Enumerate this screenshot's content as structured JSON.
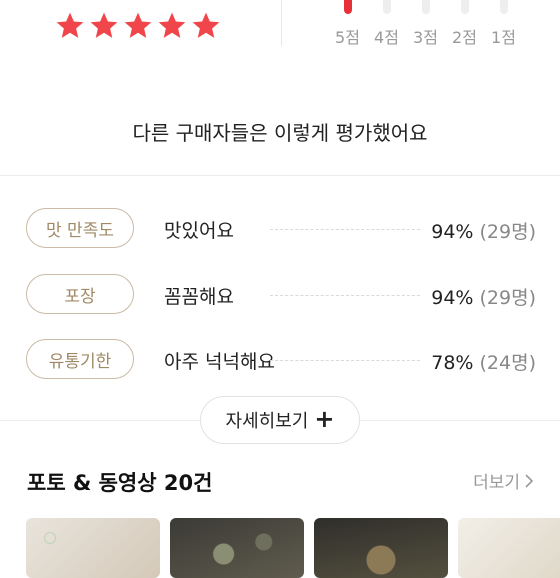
{
  "rating": {
    "stars": 5
  },
  "histogram": [
    {
      "label": "5점",
      "active": true
    },
    {
      "label": "4점",
      "active": false
    },
    {
      "label": "3점",
      "active": false
    },
    {
      "label": "2점",
      "active": false
    },
    {
      "label": "1점",
      "active": false
    }
  ],
  "summary": {
    "title": "다른 구매자들은 이렇게 평가했어요",
    "rows": [
      {
        "tag": "맛 만족도",
        "desc": "맛있어요",
        "pct": "94%",
        "count": "(29명)"
      },
      {
        "tag": "포장",
        "desc": "꼼꼼해요",
        "pct": "94%",
        "count": "(29명)"
      },
      {
        "tag": "유통기한",
        "desc": "아주 넉넉해요",
        "pct": "78%",
        "count": "(24명)"
      }
    ],
    "more_label": "자세히보기"
  },
  "media": {
    "title": "포토 & 동영상 20건",
    "more_label": "더보기"
  },
  "colors": {
    "star": "#f0454a",
    "accent_bar": "#e8303a",
    "tag_border": "#c9bba5",
    "tag_text": "#a08a66"
  }
}
